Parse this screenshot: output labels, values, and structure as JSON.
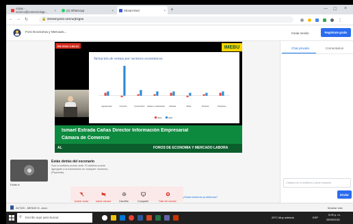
{
  "browser": {
    "tabs": [
      {
        "label": "Actas - recnico@comerciologr...",
        "color": "#ea4335",
        "active": false
      },
      {
        "label": "(2) WhatsApp",
        "color": "#25d366",
        "active": false
      },
      {
        "label": "StreamYard",
        "color": "#3b5bdb",
        "active": true
      }
    ],
    "new_tab": "+",
    "url": "streamyard.com/u/jhzjpio"
  },
  "app": {
    "title": "Foro Economía y Mercado...",
    "login": "Iniciar sesión",
    "register": "Regístrate gratis"
  },
  "stream": {
    "live_badge": "EN VIVO 1:00:21",
    "brand": "IMEBU",
    "slide_title": "Variación de ventas por sectores económicos",
    "legend": [
      "2019",
      "2020"
    ],
    "lower_third_name": "Ismael Estrada Cañas Director Información Empresarial",
    "lower_third_org": "Cámara de Comercio",
    "ticker_left": "AL",
    "ticker_right": "FOROS DE ECONOMÍA Y MERCADO LABORA"
  },
  "chart_data": {
    "type": "bar",
    "title": "Variación de ventas por sectores económicos",
    "categories": [
      "Agropecuario",
      "Comercio",
      "Construcción",
      "Hoteles y restaurantes",
      "Industria",
      "Minas",
      "Servicios",
      "Transporte"
    ],
    "series": [
      {
        "name": "2019",
        "color": "#e8453c",
        "values": [
          2,
          -1,
          1,
          1,
          2,
          -1,
          1,
          2
        ]
      },
      {
        "name": "2020",
        "color": "#2e8bd6",
        "values": [
          3,
          21,
          4,
          3,
          3,
          2,
          2,
          3
        ]
      }
    ],
    "ylim": [
      -4,
      22
    ]
  },
  "presenter": {
    "name": "Estás detrás del escenario",
    "desc": "Solo el anfitrión puede verte. El anfitrión puede agregarte a la transmisión en cualquier momento. (Pepsmite)",
    "self_label": "Estás tú"
  },
  "controls": [
    {
      "label": "Activar audio",
      "icon": "mic-off-icon",
      "red": true
    },
    {
      "label": "Iniciar cámara",
      "icon": "camera-off-icon",
      "red": true
    },
    {
      "label": "Cám/Mic",
      "icon": "gear-icon",
      "red": false
    },
    {
      "label": "Compartir",
      "icon": "share-screen-icon",
      "red": false
    },
    {
      "label": "Salir del estudio",
      "icon": "exit-icon",
      "red": true
    }
  ],
  "help_link": "¿Estás teniendo problemas?",
  "chat": {
    "tab_private": "Chat privado",
    "tab_comments": "Comentarios",
    "placeholder": "Chatea con el anfitrión y otros invitados",
    "send": "Enviar"
  },
  "download_bar": {
    "file": "ACTAS - MESAS D...docx",
    "show_all": "Mostrar todo"
  },
  "taskbar": {
    "search": "Escribe aquí para buscar",
    "weather": "25°C Muy nublado",
    "lang": "ESP",
    "time": "5:09 p. m.",
    "date": "28/09/2021"
  }
}
